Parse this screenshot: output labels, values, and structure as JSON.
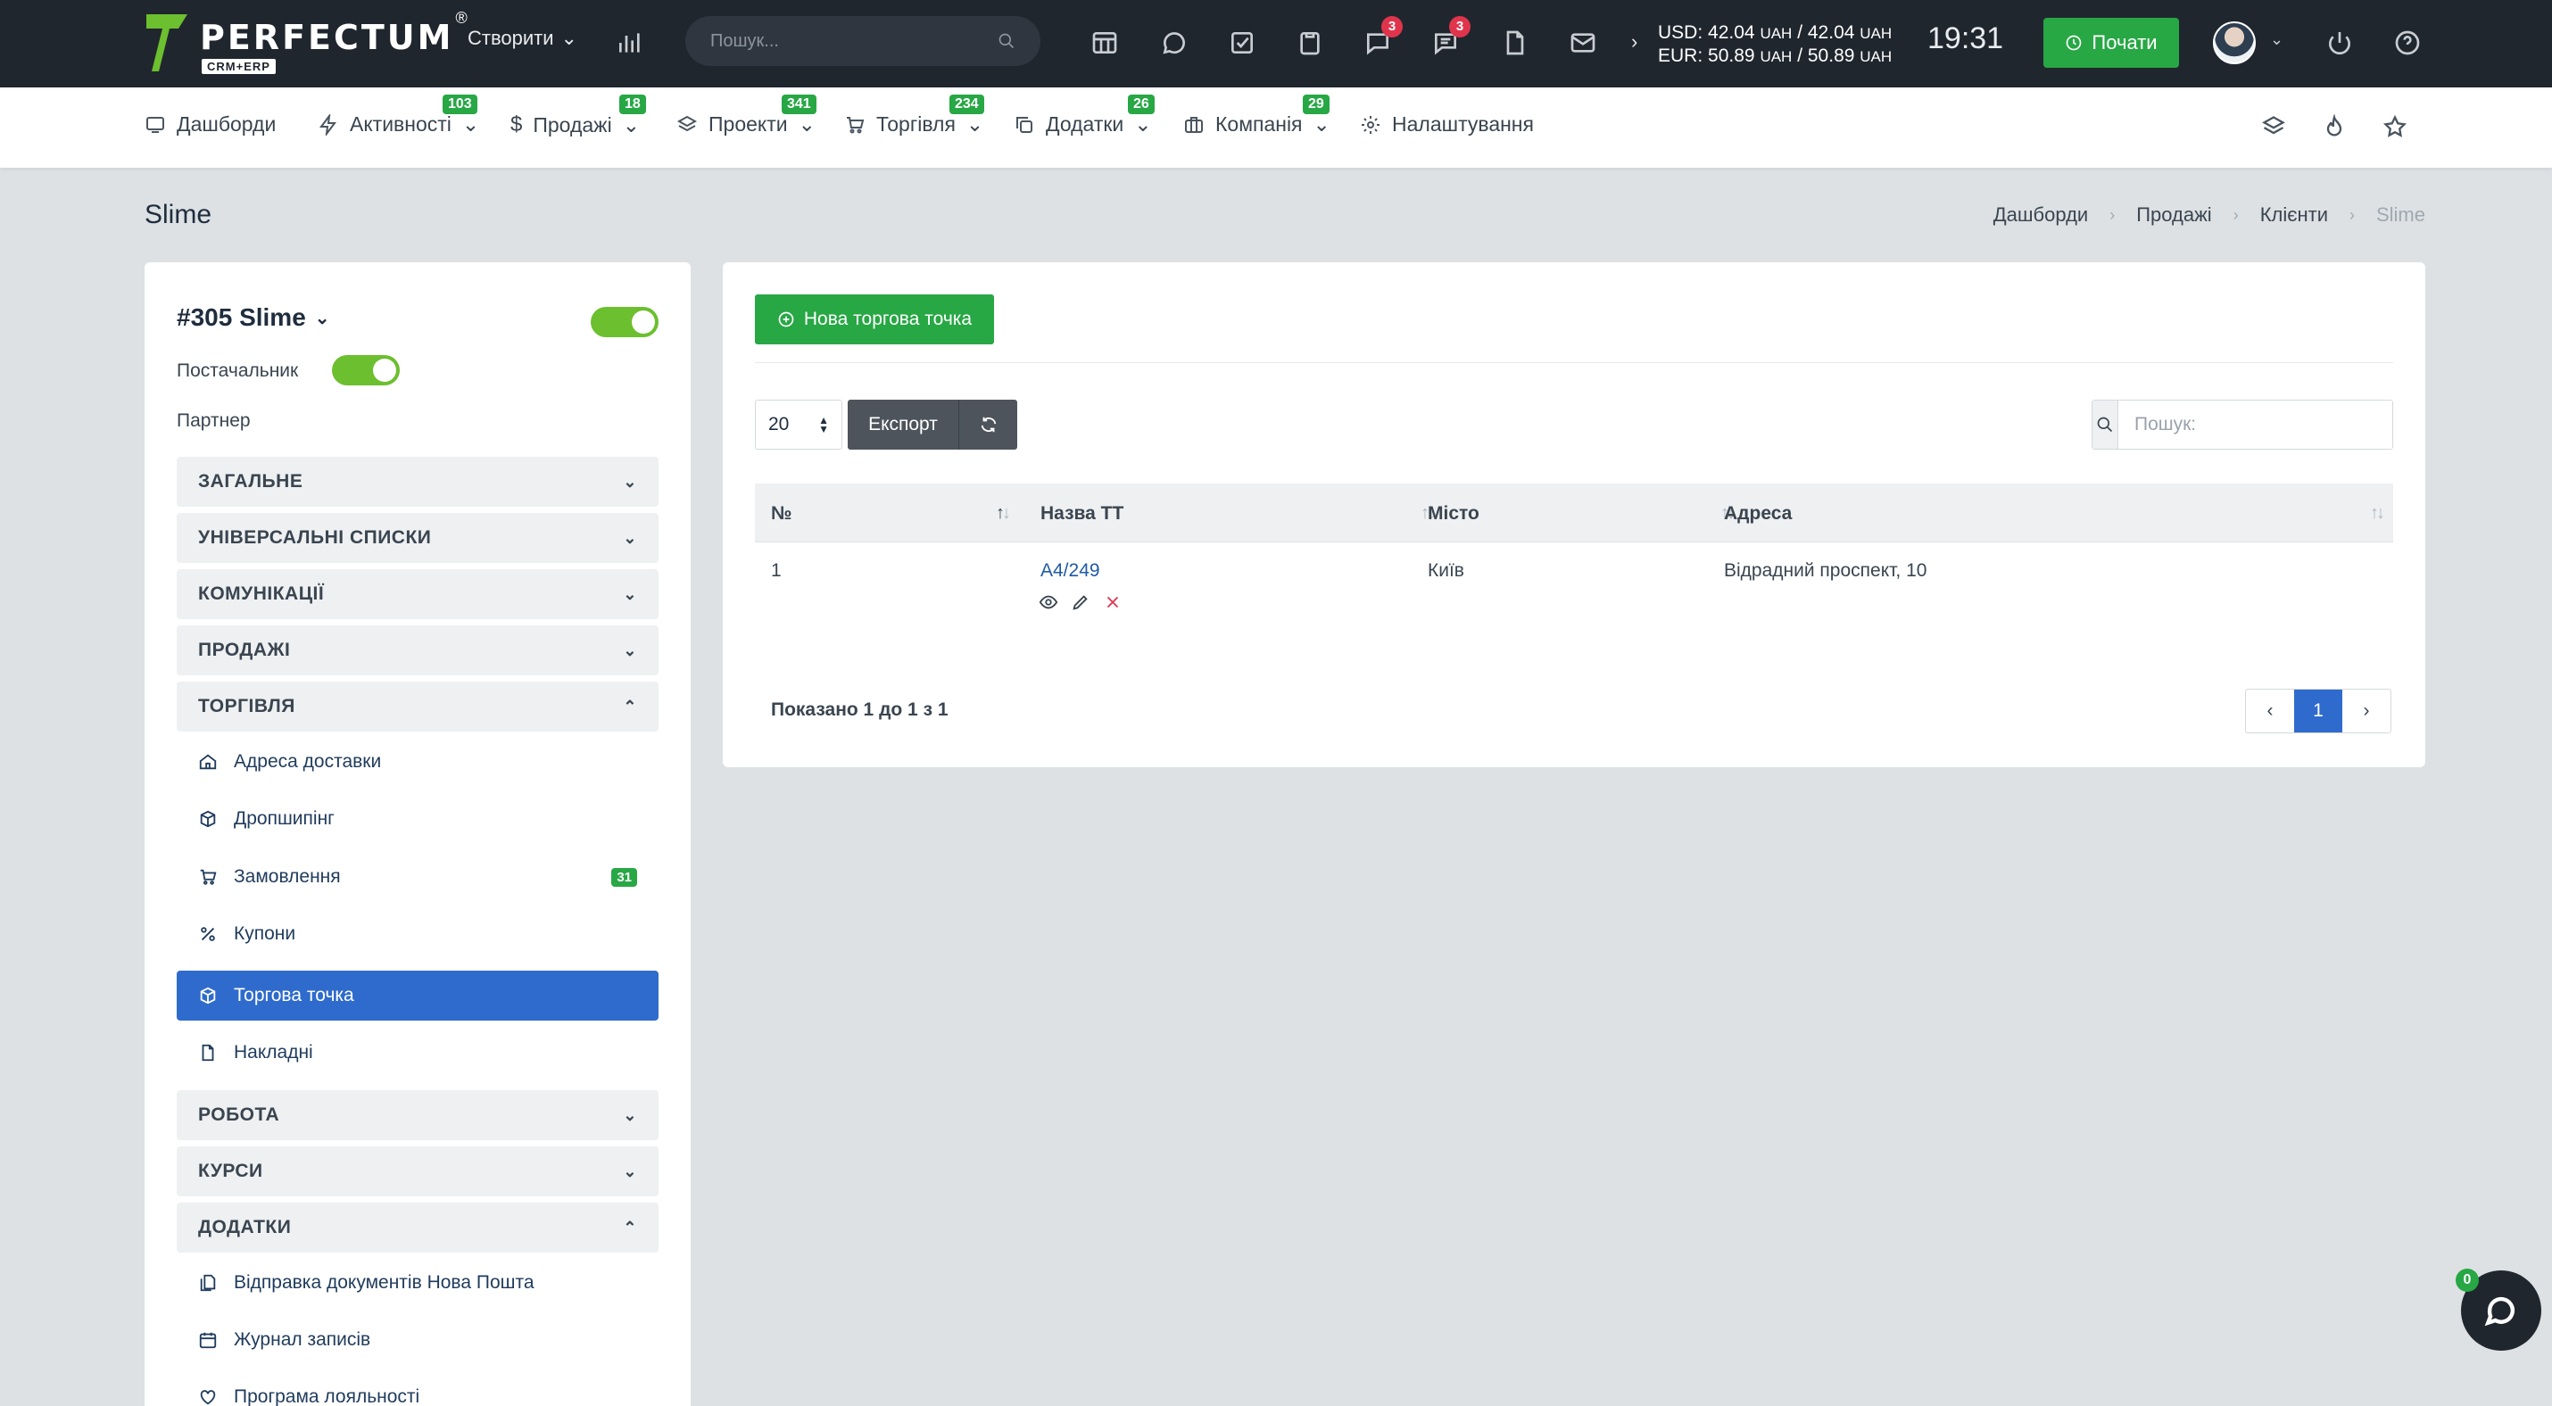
{
  "header": {
    "logo_text": "PERFECTUM",
    "logo_sub": "CRM+ERP",
    "logo_reg": "®",
    "create_label": "Створити",
    "search_placeholder": "Пошук...",
    "notifications_badge": "3",
    "messages_badge": "3",
    "rates": {
      "usd_label": "USD:",
      "usd_buy": "42.04",
      "usd_sell": "42.04",
      "eur_label": "EUR:",
      "eur_buy": "50.89",
      "eur_sell": "50.89",
      "unit": "UAH",
      "separator": "/"
    },
    "time": "19:31",
    "start_label": "Почати"
  },
  "nav": {
    "items": [
      {
        "label": "Дашборди",
        "icon": "monitor-icon",
        "badge": ""
      },
      {
        "label": "Активності",
        "icon": "bolt-icon",
        "badge": "103"
      },
      {
        "label": "Продажі",
        "icon": "dollar-icon",
        "badge": "18"
      },
      {
        "label": "Проекти",
        "icon": "layers-icon",
        "badge": "341"
      },
      {
        "label": "Торгівля",
        "icon": "cart-icon",
        "badge": "234"
      },
      {
        "label": "Додатки",
        "icon": "copy-icon",
        "badge": "26"
      },
      {
        "label": "Компанія",
        "icon": "briefcase-icon",
        "badge": "29"
      },
      {
        "label": "Налаштування",
        "icon": "gear-icon",
        "badge": ""
      }
    ]
  },
  "page": {
    "title": "Slime",
    "breadcrumb": [
      "Дашборди",
      "Продажі",
      "Клієнти",
      "Slime"
    ]
  },
  "client": {
    "name": "#305 Slime",
    "supplier_label": "Постачальник",
    "partner_label": "Партнер",
    "sections": [
      {
        "label": "ЗАГАЛЬНЕ",
        "expanded": false
      },
      {
        "label": "УНІВЕРСАЛЬНІ СПИСКИ",
        "expanded": false
      },
      {
        "label": "КОМУНІКАЦІЇ",
        "expanded": false
      },
      {
        "label": "ПРОДАЖІ",
        "expanded": false
      },
      {
        "label": "ТОРГІВЛЯ",
        "expanded": true
      },
      {
        "label": "РОБОТА",
        "expanded": false
      },
      {
        "label": "КУРСИ",
        "expanded": false
      },
      {
        "label": "ДОДАТКИ",
        "expanded": true
      }
    ],
    "trade_items": [
      {
        "label": "Адреса доставки",
        "icon": "home-icon"
      },
      {
        "label": "Дропшипінг",
        "icon": "box-icon"
      },
      {
        "label": "Замовлення",
        "icon": "cart-icon",
        "badge": "31"
      },
      {
        "label": "Купони",
        "icon": "percent-icon"
      },
      {
        "label": "Торгова точка",
        "icon": "box-icon",
        "active": true
      },
      {
        "label": "Накладні",
        "icon": "file-icon"
      }
    ],
    "addon_items": [
      {
        "label": "Відправка документів Нова Пошта",
        "icon": "files-icon"
      },
      {
        "label": "Журнал записів",
        "icon": "calendar-icon"
      },
      {
        "label": "Програма лояльності",
        "icon": "heart-icon"
      }
    ]
  },
  "main": {
    "new_button": "Нова торгова точка",
    "page_size": "20",
    "export_label": "Експорт",
    "search_placeholder": "Пошук:",
    "columns": [
      "№",
      "Назва ТТ",
      "Місто",
      "Адреса"
    ],
    "rows": [
      {
        "num": "1",
        "name": "A4/249",
        "city": "Київ",
        "address": "Відрадний проспект, 10"
      }
    ],
    "info": "Показано 1 до 1 з 1",
    "current_page": "1"
  },
  "chat": {
    "badge": "0"
  },
  "colors": {
    "accent_green": "#28a745",
    "accent_blue": "#2f6bcc",
    "topbar": "#20262e",
    "badge_red": "#e0344d"
  }
}
